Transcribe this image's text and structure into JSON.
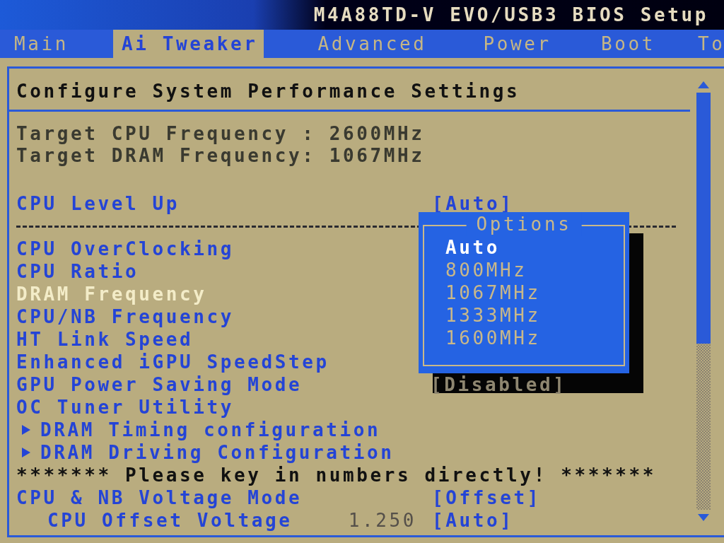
{
  "window": {
    "title": "M4A88TD-V EVO/USB3 BIOS Setup"
  },
  "tabs": [
    {
      "label": "Main",
      "selected": false
    },
    {
      "label": "Ai Tweaker",
      "selected": true
    },
    {
      "label": "Advanced",
      "selected": false
    },
    {
      "label": "Power",
      "selected": false
    },
    {
      "label": "Boot",
      "selected": false
    },
    {
      "label": "To",
      "selected": false
    }
  ],
  "heading": "Configure System Performance Settings",
  "info": [
    "Target CPU Frequency : 2600MHz",
    "Target DRAM Frequency: 1067MHz"
  ],
  "items": [
    {
      "kind": "setting",
      "label": "CPU Level Up",
      "value": "[Auto]",
      "selected": false
    },
    {
      "kind": "separator"
    },
    {
      "kind": "setting",
      "label": "CPU OverClocking",
      "selected": false
    },
    {
      "kind": "setting",
      "label": "CPU Ratio",
      "selected": false
    },
    {
      "kind": "setting",
      "label": "DRAM Frequency",
      "selected": true
    },
    {
      "kind": "setting",
      "label": "CPU/NB Frequency",
      "selected": false
    },
    {
      "kind": "setting",
      "label": "HT Link Speed",
      "selected": false
    },
    {
      "kind": "setting",
      "label": "Enhanced iGPU SpeedStep",
      "selected": false
    },
    {
      "kind": "setting",
      "label": "GPU Power Saving Mode",
      "value": "[Disabled]",
      "selected": false
    },
    {
      "kind": "setting",
      "label": "OC Tuner Utility",
      "selected": false
    },
    {
      "kind": "submenu",
      "label": "DRAM Timing configuration",
      "selected": false
    },
    {
      "kind": "submenu",
      "label": "DRAM Driving Configuration",
      "selected": false
    },
    {
      "kind": "notice",
      "label": "******* Please key in numbers directly! *******"
    },
    {
      "kind": "setting",
      "label": "CPU & NB Voltage Mode",
      "value": "[Offset]",
      "selected": false
    },
    {
      "kind": "sub_setting",
      "label": "CPU Offset Voltage",
      "reading": "1.250",
      "value": "[Auto]",
      "selected": false
    }
  ],
  "popup": {
    "title": "Options",
    "options": [
      {
        "label": "Auto",
        "selected": true
      },
      {
        "label": "800MHz",
        "selected": false
      },
      {
        "label": "1067MHz",
        "selected": false
      },
      {
        "label": "1333MHz",
        "selected": false
      },
      {
        "label": "1600MHz",
        "selected": false
      }
    ]
  }
}
